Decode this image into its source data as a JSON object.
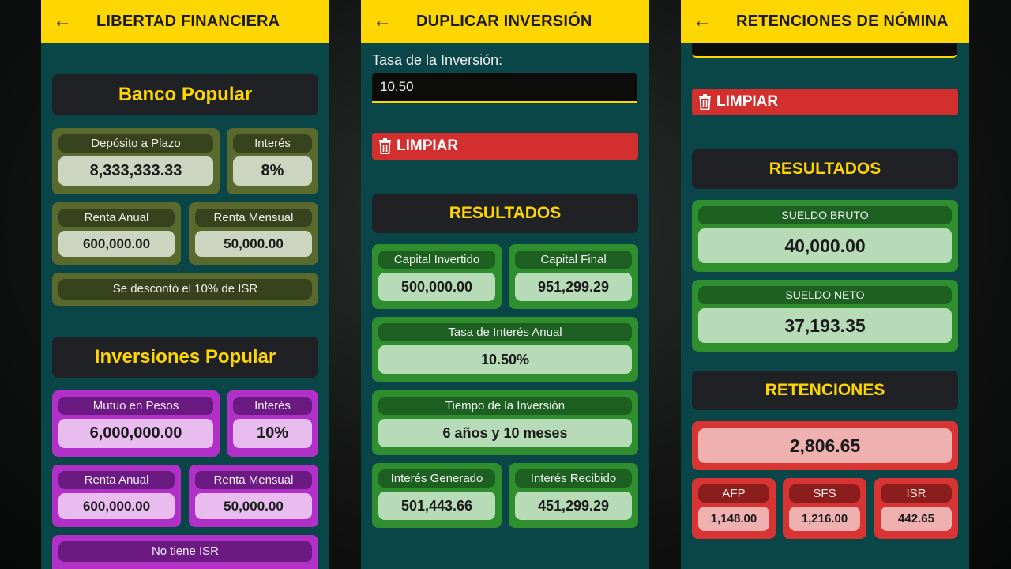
{
  "screens": [
    {
      "title": "LIBERTAD FINANCIERA",
      "banco": {
        "header": "Banco Popular",
        "deposito_label": "Depósito a Plazo",
        "deposito_value": "8,333,333.33",
        "interes_label": "Interés",
        "interes_value": "8%",
        "renta_anual_label": "Renta Anual",
        "renta_anual_value": "600,000.00",
        "renta_mensual_label": "Renta Mensual",
        "renta_mensual_value": "50,000.00",
        "note": "Se descontó el 10% de ISR"
      },
      "inversiones": {
        "header": "Inversiones Popular",
        "mutuo_label": "Mutuo en Pesos",
        "mutuo_value": "6,000,000.00",
        "interes_label": "Interés",
        "interes_value": "10%",
        "renta_anual_label": "Renta Anual",
        "renta_anual_value": "600,000.00",
        "renta_mensual_label": "Renta Mensual",
        "renta_mensual_value": "50,000.00",
        "note": "No tiene ISR"
      }
    },
    {
      "title": "DUPLICAR INVERSIÓN",
      "input_label": "Tasa de la Inversión:",
      "input_value": "10.50",
      "clear_label": "LIMPIAR",
      "results_header": "RESULTADOS",
      "capital_invertido_label": "Capital Invertido",
      "capital_invertido_value": "500,000.00",
      "capital_final_label": "Capital Final",
      "capital_final_value": "951,299.29",
      "tasa_label": "Tasa de Interés Anual",
      "tasa_value": "10.50%",
      "tiempo_label": "Tiempo de la Inversión",
      "tiempo_value": "6 años y 10 meses",
      "interes_generado_label": "Interés Generado",
      "interes_generado_value": "501,443.66",
      "interes_recibido_label": "Interés Recibido",
      "interes_recibido_value": "451,299.29"
    },
    {
      "title": "RETENCIONES DE NÓMINA",
      "clear_label": "LIMPIAR",
      "results_header": "RESULTADOS",
      "sueldo_bruto_label": "SUELDO BRUTO",
      "sueldo_bruto_value": "40,000.00",
      "sueldo_neto_label": "SUELDO NETO",
      "sueldo_neto_value": "37,193.35",
      "retenciones_header": "RETENCIONES",
      "retenciones_total": "2,806.65",
      "afp_label": "AFP",
      "afp_value": "1,148.00",
      "sfs_label": "SFS",
      "sfs_value": "1,216.00",
      "isr_label": "ISR",
      "isr_value": "442.65"
    }
  ],
  "icons": {
    "back": "arrow-left-icon",
    "clear": "trash-icon"
  },
  "colors": {
    "appbar": "#ffd700",
    "background": "#0a4548",
    "header_text": "#ffd700",
    "clear_button": "#d32f2f"
  }
}
